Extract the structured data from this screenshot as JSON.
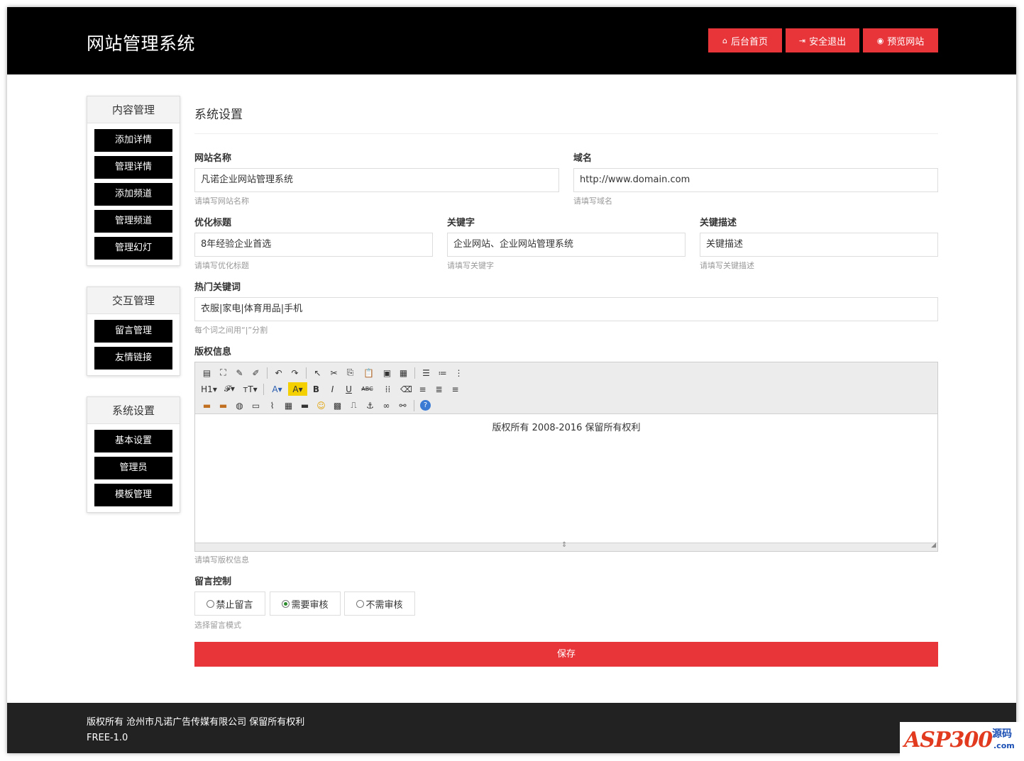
{
  "header": {
    "brand": "网站管理系统",
    "buttons": [
      {
        "icon": "home-icon",
        "glyph": "⌂",
        "label": "后台首页"
      },
      {
        "icon": "signout-icon",
        "glyph": "⇥",
        "label": "安全退出"
      },
      {
        "icon": "eye-icon",
        "glyph": "◉",
        "label": "预览网站"
      }
    ]
  },
  "sidebar": [
    {
      "title": "内容管理",
      "items": [
        "添加详情",
        "管理详情",
        "添加频道",
        "管理频道",
        "管理幻灯"
      ]
    },
    {
      "title": "交互管理",
      "items": [
        "留言管理",
        "友情链接"
      ]
    },
    {
      "title": "系统设置",
      "items": [
        "基本设置",
        "管理员",
        "模板管理"
      ]
    }
  ],
  "page": {
    "title": "系统设置",
    "site_name": {
      "label": "网站名称",
      "value": "凡诺企业网站管理系统",
      "help": "请填写网站名称"
    },
    "domain": {
      "label": "域名",
      "value": "http://www.domain.com",
      "help": "请填写域名"
    },
    "seo_title": {
      "label": "优化标题",
      "value": "8年经验企业首选",
      "help": "请填写优化标题"
    },
    "keywords": {
      "label": "关键字",
      "value": "企业网站、企业网站管理系统",
      "help": "请填写关键字"
    },
    "description": {
      "label": "关键描述",
      "value": "关键描述",
      "help": "请填写关键描述"
    },
    "hot_keywords": {
      "label": "热门关键词",
      "value": "衣服|家电|体育用品|手机",
      "help": "每个词之间用“|”分割"
    },
    "copyright": {
      "label": "版权信息",
      "content": "版权所有 2008-2016 保留所有权利",
      "help": "请填写版权信息"
    },
    "message_control": {
      "label": "留言控制",
      "options": [
        "禁止留言",
        "需要审核",
        "不需审核"
      ],
      "selected": "需要审核",
      "help": "选择留言模式"
    },
    "save_label": "保存"
  },
  "editor_toolbar": {
    "row1": [
      "source-icon",
      "fullscreen-icon",
      "format-brush-icon",
      "autotypeset-icon",
      "|",
      "undo-icon",
      "redo-icon",
      "|",
      "select-icon",
      "cut-icon",
      "copy-icon",
      "paste-icon",
      "paste-text-icon",
      "paste-word-icon",
      "|",
      "unordered-list-icon",
      "ordered-list-icon",
      "more-icon"
    ],
    "row2": [
      "heading-icon",
      "font-family-icon",
      "font-size-icon",
      "|",
      "font-color-icon",
      "highlight-icon",
      "bold-icon",
      "italic-icon",
      "underline-icon",
      "strikethrough-icon",
      "line-height-icon",
      "remove-format-icon",
      "align-left-icon",
      "align-center-icon",
      "align-right-icon"
    ],
    "row3": [
      "insert-image-icon",
      "multi-image-icon",
      "flash-icon",
      "media-icon",
      "attachment-icon",
      "table-icon",
      "code-icon",
      "emoticon-icon",
      "map-icon",
      "pagebreak-icon",
      "anchor-icon",
      "link-icon",
      "unlink-icon",
      "|",
      "help-icon"
    ],
    "glyphs": {
      "source-icon": "▤",
      "fullscreen-icon": "⛶",
      "format-brush-icon": "✎",
      "autotypeset-icon": "✐",
      "undo-icon": "↶",
      "redo-icon": "↷",
      "select-icon": "↖",
      "cut-icon": "✂",
      "copy-icon": "⎘",
      "paste-icon": "📋",
      "paste-text-icon": "▣",
      "paste-word-icon": "▦",
      "unordered-list-icon": "☰",
      "ordered-list-icon": "≔",
      "more-icon": "⋮",
      "heading-icon": "H1▾",
      "font-family-icon": "𝓕▾",
      "font-size-icon": "тT▾",
      "font-color-icon": "A▾",
      "highlight-icon": "A▾",
      "bold-icon": "B",
      "italic-icon": "I",
      "underline-icon": "U",
      "strikethrough-icon": "ABC",
      "line-height-icon": "⁞⁞",
      "remove-format-icon": "⌫",
      "align-left-icon": "≡",
      "align-center-icon": "≣",
      "align-right-icon": "≡",
      "insert-image-icon": "▬",
      "multi-image-icon": "▬",
      "flash-icon": "◍",
      "media-icon": "▭",
      "attachment-icon": "⌇",
      "table-icon": "▦",
      "code-icon": "▬",
      "emoticon-icon": "☺",
      "map-icon": "▩",
      "pagebreak-icon": "⎍",
      "anchor-icon": "⚓",
      "link-icon": "∞",
      "unlink-icon": "⚯",
      "help-icon": "?"
    }
  },
  "footer": {
    "copyright": "版权所有 沧州市凡诺广告传媒有限公司 保留所有权利",
    "version": "FREE-1.0"
  },
  "watermark": {
    "logo": "ASP300",
    "cn": "源码",
    "domain": ".com"
  },
  "colors": {
    "accent": "#e8353a",
    "header_bg": "#000000",
    "footer_bg": "#222222",
    "sidebar_item_bg": "#000000"
  }
}
